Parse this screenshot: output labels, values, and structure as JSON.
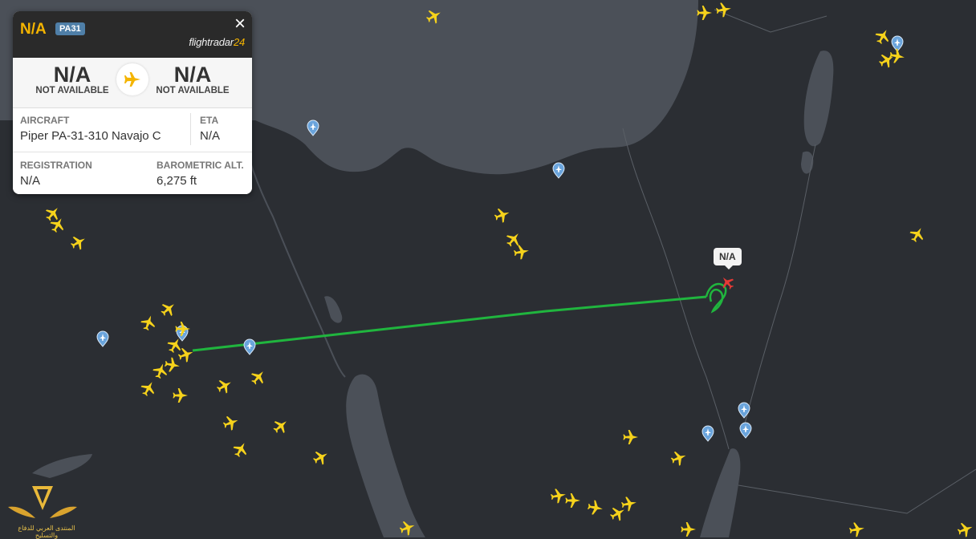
{
  "flight": {
    "callsign": "N/A",
    "aircraft_code": "PA31",
    "close_glyph": "×",
    "brand_main": "flightradar",
    "brand_num": "24"
  },
  "route": {
    "origin_code": "N/A",
    "origin_name": "NOT AVAILABLE",
    "destination_code": "N/A",
    "destination_name": "NOT AVAILABLE"
  },
  "details": {
    "aircraft_label": "AIRCRAFT",
    "aircraft_value": "Piper PA-31-310 Navajo C",
    "eta_label": "ETA",
    "eta_value": "N/A",
    "registration_label": "REGISTRATION",
    "registration_value": "N/A",
    "altitude_label": "BAROMETRIC ALT.",
    "altitude_value": "6,275 ft"
  },
  "map": {
    "selected_label": "N/A",
    "colors": {
      "land": "#2b2e33",
      "sea": "#4b5058",
      "track": "#20b53e",
      "aircraft": "#f6d21b",
      "selected": "#e53935",
      "airport": "#6aa4dc"
    }
  },
  "watermark": {
    "text": "المنتدى العربي للدفاع والتسليح"
  }
}
